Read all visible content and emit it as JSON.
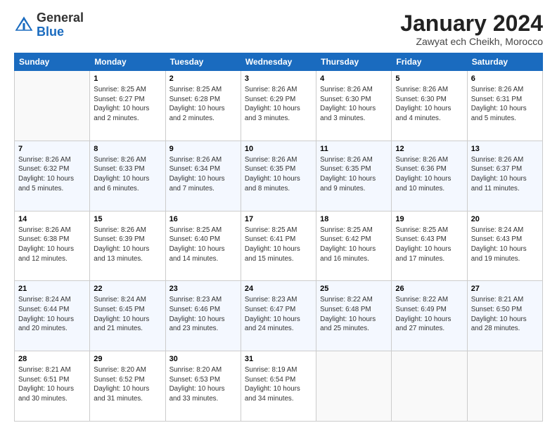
{
  "logo": {
    "general": "General",
    "blue": "Blue"
  },
  "header": {
    "month_title": "January 2024",
    "location": "Zawyat ech Cheikh, Morocco"
  },
  "days_of_week": [
    "Sunday",
    "Monday",
    "Tuesday",
    "Wednesday",
    "Thursday",
    "Friday",
    "Saturday"
  ],
  "weeks": [
    [
      {
        "day": "",
        "info": ""
      },
      {
        "day": "1",
        "info": "Sunrise: 8:25 AM\nSunset: 6:27 PM\nDaylight: 10 hours\nand 2 minutes."
      },
      {
        "day": "2",
        "info": "Sunrise: 8:25 AM\nSunset: 6:28 PM\nDaylight: 10 hours\nand 2 minutes."
      },
      {
        "day": "3",
        "info": "Sunrise: 8:26 AM\nSunset: 6:29 PM\nDaylight: 10 hours\nand 3 minutes."
      },
      {
        "day": "4",
        "info": "Sunrise: 8:26 AM\nSunset: 6:30 PM\nDaylight: 10 hours\nand 3 minutes."
      },
      {
        "day": "5",
        "info": "Sunrise: 8:26 AM\nSunset: 6:30 PM\nDaylight: 10 hours\nand 4 minutes."
      },
      {
        "day": "6",
        "info": "Sunrise: 8:26 AM\nSunset: 6:31 PM\nDaylight: 10 hours\nand 5 minutes."
      }
    ],
    [
      {
        "day": "7",
        "info": "Sunrise: 8:26 AM\nSunset: 6:32 PM\nDaylight: 10 hours\nand 5 minutes."
      },
      {
        "day": "8",
        "info": "Sunrise: 8:26 AM\nSunset: 6:33 PM\nDaylight: 10 hours\nand 6 minutes."
      },
      {
        "day": "9",
        "info": "Sunrise: 8:26 AM\nSunset: 6:34 PM\nDaylight: 10 hours\nand 7 minutes."
      },
      {
        "day": "10",
        "info": "Sunrise: 8:26 AM\nSunset: 6:35 PM\nDaylight: 10 hours\nand 8 minutes."
      },
      {
        "day": "11",
        "info": "Sunrise: 8:26 AM\nSunset: 6:35 PM\nDaylight: 10 hours\nand 9 minutes."
      },
      {
        "day": "12",
        "info": "Sunrise: 8:26 AM\nSunset: 6:36 PM\nDaylight: 10 hours\nand 10 minutes."
      },
      {
        "day": "13",
        "info": "Sunrise: 8:26 AM\nSunset: 6:37 PM\nDaylight: 10 hours\nand 11 minutes."
      }
    ],
    [
      {
        "day": "14",
        "info": "Sunrise: 8:26 AM\nSunset: 6:38 PM\nDaylight: 10 hours\nand 12 minutes."
      },
      {
        "day": "15",
        "info": "Sunrise: 8:26 AM\nSunset: 6:39 PM\nDaylight: 10 hours\nand 13 minutes."
      },
      {
        "day": "16",
        "info": "Sunrise: 8:25 AM\nSunset: 6:40 PM\nDaylight: 10 hours\nand 14 minutes."
      },
      {
        "day": "17",
        "info": "Sunrise: 8:25 AM\nSunset: 6:41 PM\nDaylight: 10 hours\nand 15 minutes."
      },
      {
        "day": "18",
        "info": "Sunrise: 8:25 AM\nSunset: 6:42 PM\nDaylight: 10 hours\nand 16 minutes."
      },
      {
        "day": "19",
        "info": "Sunrise: 8:25 AM\nSunset: 6:43 PM\nDaylight: 10 hours\nand 17 minutes."
      },
      {
        "day": "20",
        "info": "Sunrise: 8:24 AM\nSunset: 6:43 PM\nDaylight: 10 hours\nand 19 minutes."
      }
    ],
    [
      {
        "day": "21",
        "info": "Sunrise: 8:24 AM\nSunset: 6:44 PM\nDaylight: 10 hours\nand 20 minutes."
      },
      {
        "day": "22",
        "info": "Sunrise: 8:24 AM\nSunset: 6:45 PM\nDaylight: 10 hours\nand 21 minutes."
      },
      {
        "day": "23",
        "info": "Sunrise: 8:23 AM\nSunset: 6:46 PM\nDaylight: 10 hours\nand 23 minutes."
      },
      {
        "day": "24",
        "info": "Sunrise: 8:23 AM\nSunset: 6:47 PM\nDaylight: 10 hours\nand 24 minutes."
      },
      {
        "day": "25",
        "info": "Sunrise: 8:22 AM\nSunset: 6:48 PM\nDaylight: 10 hours\nand 25 minutes."
      },
      {
        "day": "26",
        "info": "Sunrise: 8:22 AM\nSunset: 6:49 PM\nDaylight: 10 hours\nand 27 minutes."
      },
      {
        "day": "27",
        "info": "Sunrise: 8:21 AM\nSunset: 6:50 PM\nDaylight: 10 hours\nand 28 minutes."
      }
    ],
    [
      {
        "day": "28",
        "info": "Sunrise: 8:21 AM\nSunset: 6:51 PM\nDaylight: 10 hours\nand 30 minutes."
      },
      {
        "day": "29",
        "info": "Sunrise: 8:20 AM\nSunset: 6:52 PM\nDaylight: 10 hours\nand 31 minutes."
      },
      {
        "day": "30",
        "info": "Sunrise: 8:20 AM\nSunset: 6:53 PM\nDaylight: 10 hours\nand 33 minutes."
      },
      {
        "day": "31",
        "info": "Sunrise: 8:19 AM\nSunset: 6:54 PM\nDaylight: 10 hours\nand 34 minutes."
      },
      {
        "day": "",
        "info": ""
      },
      {
        "day": "",
        "info": ""
      },
      {
        "day": "",
        "info": ""
      }
    ]
  ]
}
